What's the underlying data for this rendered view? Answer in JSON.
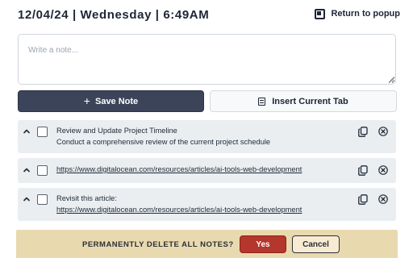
{
  "header": {
    "datetime": "12/04/24 | Wednesday | 6:49AM",
    "return_label": "Return to popup"
  },
  "note_input": {
    "placeholder": "Write a note...",
    "value": ""
  },
  "actions": {
    "save_label": "Save Note",
    "insert_tab_label": "Insert Current Tab"
  },
  "notes": [
    {
      "title": "Review and Update Project Timeline",
      "body": "Conduct a comprehensive review of the current project schedule",
      "checked": false
    },
    {
      "title": "",
      "body": "https://www.digitalocean.com/resources/articles/ai-tools-web-development",
      "checked": false
    },
    {
      "title": "Revisit this article:",
      "body": "https://www.digitalocean.com/resources/articles/ai-tools-web-development",
      "checked": false
    }
  ],
  "confirm": {
    "prompt": "PERMANENTLY DELETE ALL NOTES?",
    "yes_label": "Yes",
    "cancel_label": "Cancel"
  },
  "icons": {
    "popup": "window-icon",
    "save": "plus-icon",
    "insert": "list-icon",
    "expand": "chevron-up-icon",
    "copy": "copy-icon",
    "delete": "close-circle-icon"
  },
  "colors": {
    "primary_button": "#3b4459",
    "note_background": "#eaeef1",
    "confirm_background": "#e9d9af",
    "danger": "#b5362c"
  }
}
